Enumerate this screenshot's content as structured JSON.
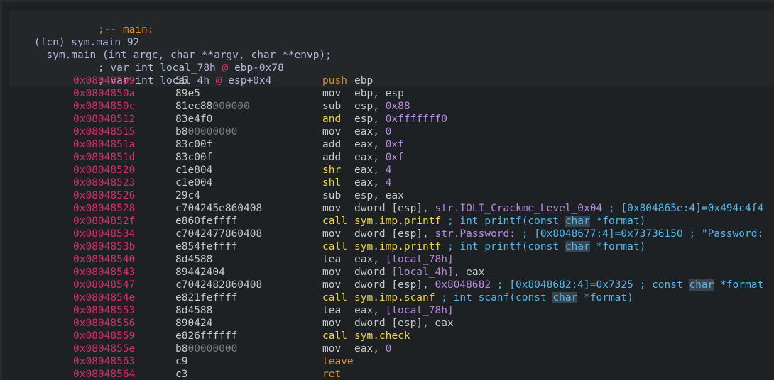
{
  "header": {
    "label_line": ";-- main:",
    "fcn_line": "(fcn) sym.main 92",
    "sig_line": "  sym.main (int argc, char **argv, char **envp);",
    "var1": {
      "prefix": "; var int local_78h ",
      "at": "@",
      "suffix": " ebp-0x78"
    },
    "var2": {
      "prefix": "; var int local_4h ",
      "at": "@",
      "suffix": " esp+0x4"
    }
  },
  "rows": [
    {
      "addr": "0x08048509",
      "b1": "55",
      "b2": "",
      "mn": "push",
      "ops": "ebp",
      "num": "",
      "cmt": ""
    },
    {
      "addr": "0x0804850a",
      "b1": "89e5",
      "b2": "",
      "mn": "mov",
      "ops": "ebp, esp",
      "num": "",
      "cmt": ""
    },
    {
      "addr": "0x0804850c",
      "b1": "81ec88",
      "b2": "000000",
      "mn": "sub",
      "ops": "esp, ",
      "num": "0x88",
      "cmt": ""
    },
    {
      "addr": "0x08048512",
      "b1": "83e4f0",
      "b2": "",
      "mn": "and",
      "ops": "esp, ",
      "num": "0xfffffff0",
      "cmt": ""
    },
    {
      "addr": "0x08048515",
      "b1": "b8",
      "b2": "00000000",
      "mn": "mov",
      "ops": "eax, ",
      "num": "0",
      "cmt": ""
    },
    {
      "addr": "0x0804851a",
      "b1": "83c00f",
      "b2": "",
      "mn": "add",
      "ops": "eax, ",
      "num": "0xf",
      "cmt": ""
    },
    {
      "addr": "0x0804851d",
      "b1": "83c00f",
      "b2": "",
      "mn": "add",
      "ops": "eax, ",
      "num": "0xf",
      "cmt": ""
    },
    {
      "addr": "0x08048520",
      "b1": "c1e804",
      "b2": "",
      "mn": "shr",
      "ops": "eax, ",
      "num": "4",
      "cmt": ""
    },
    {
      "addr": "0x08048523",
      "b1": "c1e004",
      "b2": "",
      "mn": "shl",
      "ops": "eax, ",
      "num": "4",
      "cmt": ""
    },
    {
      "addr": "0x08048526",
      "b1": "29c4",
      "b2": "",
      "mn": "sub",
      "ops": "esp, eax",
      "num": "",
      "cmt": ""
    },
    {
      "addr": "0x08048528",
      "b1": "c704245e860408",
      "b2": "",
      "mn": "mov",
      "ops": "dword [esp], ",
      "num": "str.IOLI_Crackme_Level_0x04",
      "cmt": " ; [0x804865e:4]=0x494c4f4"
    },
    {
      "addr": "0x0804852f",
      "b1": "e860feffff",
      "b2": "",
      "mn": "call",
      "ops": "",
      "num": "sym.imp.printf",
      "cmt": " ; int printf(const ",
      "kw": "char",
      "tail": " *format)"
    },
    {
      "addr": "0x08048534",
      "b1": "c7042477860408",
      "b2": "",
      "mn": "mov",
      "ops": "dword [esp], ",
      "num": "str.Password:",
      "cmt": " ; [0x8048677:4]=0x73736150 ; \"Password:"
    },
    {
      "addr": "0x0804853b",
      "b1": "e854feffff",
      "b2": "",
      "mn": "call",
      "ops": "",
      "num": "sym.imp.printf",
      "cmt": " ; int printf(const ",
      "kw": "char",
      "tail": " *format)"
    },
    {
      "addr": "0x08048540",
      "b1": "8d4588",
      "b2": "",
      "mn": "lea",
      "ops": "eax, ",
      "num": "[local_78h]",
      "cmt": ""
    },
    {
      "addr": "0x08048543",
      "b1": "89442404",
      "b2": "",
      "mn": "mov",
      "ops": "dword ",
      "num": "[local_4h]",
      "cmt": "",
      "after": ", eax"
    },
    {
      "addr": "0x08048547",
      "b1": "c7042482860408",
      "b2": "",
      "mn": "mov",
      "ops": "dword [esp], ",
      "num": "0x8048682",
      "cmt": " ; [0x8048682:4]=0x7325 ; const ",
      "kw": "char",
      "tail": " *format"
    },
    {
      "addr": "0x0804854e",
      "b1": "e821feffff",
      "b2": "",
      "mn": "call",
      "ops": "",
      "num": "sym.imp.scanf",
      "cmt": " ; int scanf(const ",
      "kw": "char",
      "tail": " *format)"
    },
    {
      "addr": "0x08048553",
      "b1": "8d4588",
      "b2": "",
      "mn": "lea",
      "ops": "eax, ",
      "num": "[local_78h]",
      "cmt": ""
    },
    {
      "addr": "0x08048556",
      "b1": "890424",
      "b2": "",
      "mn": "mov",
      "ops": "dword [esp], eax",
      "num": "",
      "cmt": ""
    },
    {
      "addr": "0x08048559",
      "b1": "e826ffffff",
      "b2": "",
      "mn": "call",
      "ops": "",
      "num": "sym.check",
      "cmt": ""
    },
    {
      "addr": "0x0804855e",
      "b1": "b8",
      "b2": "00000000",
      "mn": "mov",
      "ops": "eax, ",
      "num": "0",
      "cmt": ""
    },
    {
      "addr": "0x08048563",
      "b1": "c9",
      "b2": "",
      "mn": "leave",
      "ops": "",
      "num": "",
      "cmt": ""
    },
    {
      "addr": "0x08048564",
      "b1": "c3",
      "b2": "",
      "mn": "ret",
      "ops": "",
      "num": "",
      "cmt": ""
    }
  ],
  "colors": {
    "background": "#1e2124",
    "address": "#d62e6a",
    "comment": "#58b7e8",
    "call": "#f0d24a",
    "number": "#b98ae0"
  }
}
